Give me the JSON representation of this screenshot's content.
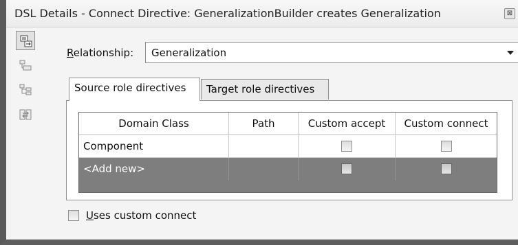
{
  "window": {
    "title": "DSL Details - Connect Directive: GeneralizationBuilder creates Generalization",
    "close_glyph": "⊠"
  },
  "toolbar": {
    "buttons": [
      {
        "icon": "connect-directive-icon",
        "active": true
      },
      {
        "icon": "element-merge-icon",
        "active": false
      },
      {
        "icon": "tree-hierarchy-icon",
        "active": false
      },
      {
        "icon": "swap-icon",
        "active": false
      }
    ]
  },
  "relationship": {
    "label_accel": "R",
    "label_rest": "elationship:",
    "value": "Generalization"
  },
  "tabs": [
    {
      "label": "Source role directives",
      "selected": true
    },
    {
      "label": "Target role directives",
      "selected": false
    }
  ],
  "grid": {
    "columns": [
      "Domain Class",
      "Path",
      "Custom accept",
      "Custom connect"
    ],
    "rows": [
      {
        "domain_class": "Component",
        "path": "",
        "custom_accept": false,
        "custom_connect": false,
        "selected": false
      },
      {
        "domain_class": "<Add new>",
        "path": "",
        "custom_accept": false,
        "custom_connect": false,
        "selected": true
      }
    ]
  },
  "uses_custom_connect": {
    "label_accel": "U",
    "label_rest": "ses custom connect",
    "checked": false
  }
}
